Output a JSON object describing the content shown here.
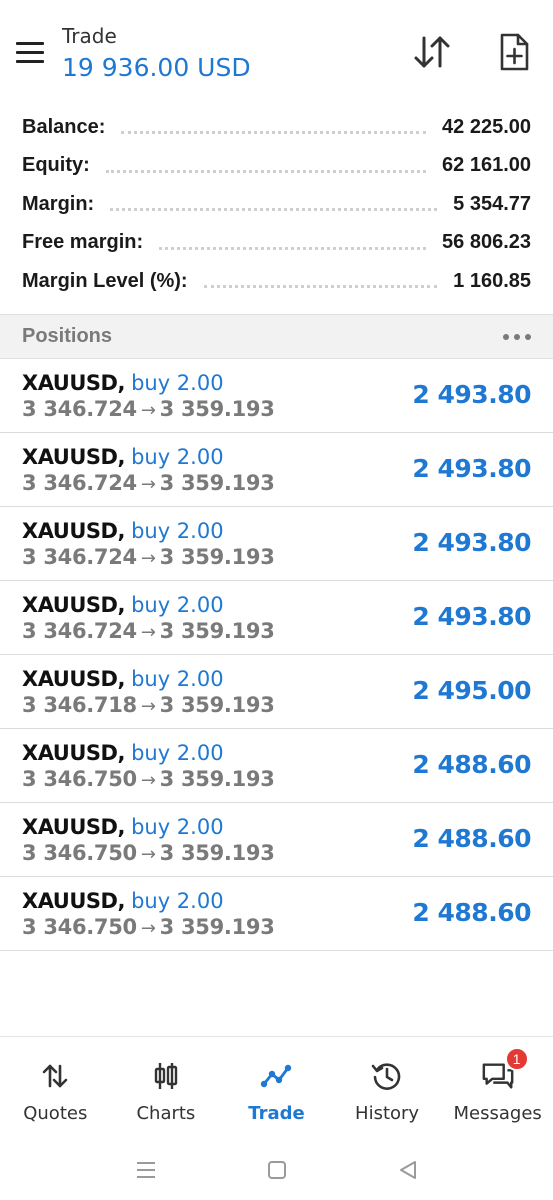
{
  "header": {
    "title": "Trade",
    "subtitle": "19 936.00 USD"
  },
  "summary": [
    {
      "label": "Balance:",
      "value": "42 225.00"
    },
    {
      "label": "Equity:",
      "value": "62 161.00"
    },
    {
      "label": "Margin:",
      "value": "5 354.77"
    },
    {
      "label": "Free margin:",
      "value": "56 806.23"
    },
    {
      "label": "Margin Level (%):",
      "value": "1 160.85"
    }
  ],
  "positions": {
    "title": "Positions",
    "items": [
      {
        "symbol": "XAUUSD,",
        "type": "buy 2.00",
        "open": "3 346.724",
        "arrow": "→",
        "current": "3 359.193",
        "profit": "2 493.80"
      },
      {
        "symbol": "XAUUSD,",
        "type": "buy 2.00",
        "open": "3 346.724",
        "arrow": "→",
        "current": "3 359.193",
        "profit": "2 493.80"
      },
      {
        "symbol": "XAUUSD,",
        "type": "buy 2.00",
        "open": "3 346.724",
        "arrow": "→",
        "current": "3 359.193",
        "profit": "2 493.80"
      },
      {
        "symbol": "XAUUSD,",
        "type": "buy 2.00",
        "open": "3 346.724",
        "arrow": "→",
        "current": "3 359.193",
        "profit": "2 493.80"
      },
      {
        "symbol": "XAUUSD,",
        "type": "buy 2.00",
        "open": "3 346.718",
        "arrow": "→",
        "current": "3 359.193",
        "profit": "2 495.00"
      },
      {
        "symbol": "XAUUSD,",
        "type": "buy 2.00",
        "open": "3 346.750",
        "arrow": "→",
        "current": "3 359.193",
        "profit": "2 488.60"
      },
      {
        "symbol": "XAUUSD,",
        "type": "buy 2.00",
        "open": "3 346.750",
        "arrow": "→",
        "current": "3 359.193",
        "profit": "2 488.60"
      },
      {
        "symbol": "XAUUSD,",
        "type": "buy 2.00",
        "open": "3 346.750",
        "arrow": "→",
        "current": "3 359.193",
        "profit": "2 488.60"
      }
    ]
  },
  "nav": {
    "items": [
      {
        "label": "Quotes",
        "icon": "quotes-icon"
      },
      {
        "label": "Charts",
        "icon": "charts-icon"
      },
      {
        "label": "Trade",
        "icon": "trade-icon"
      },
      {
        "label": "History",
        "icon": "history-icon"
      },
      {
        "label": "Messages",
        "icon": "messages-icon"
      }
    ],
    "messages_badge": "1",
    "active": "Trade"
  },
  "colors": {
    "accent": "#1f78d1",
    "badge": "#e53935",
    "muted": "#7a7a7a"
  }
}
